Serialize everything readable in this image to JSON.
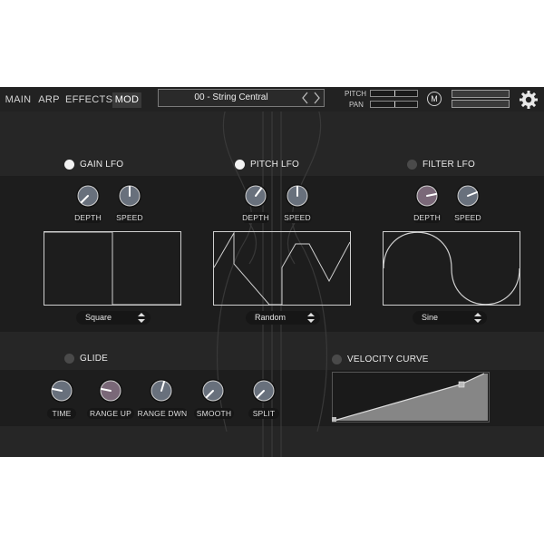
{
  "tabs": [
    {
      "label": "MAIN",
      "active": false
    },
    {
      "label": "ARP",
      "active": false
    },
    {
      "label": "EFFECTS",
      "active": false
    },
    {
      "label": "MOD",
      "active": true
    }
  ],
  "preset": {
    "name": "00 - String Central"
  },
  "header_controls": {
    "pitch_label": "PITCH",
    "pan_label": "PAN",
    "m_button": "M"
  },
  "lfo_sections": [
    {
      "title": "GAIN LFO",
      "enabled": true,
      "depth_label": "DEPTH",
      "speed_label": "SPEED",
      "waveform": "Square"
    },
    {
      "title": "PITCH LFO",
      "enabled": true,
      "depth_label": "DEPTH",
      "speed_label": "SPEED",
      "waveform": "Random"
    },
    {
      "title": "FILTER LFO",
      "enabled": false,
      "depth_label": "DEPTH",
      "speed_label": "SPEED",
      "waveform": "Sine"
    }
  ],
  "glide": {
    "title": "GLIDE",
    "enabled": false,
    "knobs": [
      {
        "label": "TIME"
      },
      {
        "label": "RANGE UP"
      },
      {
        "label": "RANGE DWN"
      },
      {
        "label": "SMOOTH"
      },
      {
        "label": "SPLIT"
      }
    ]
  },
  "velocity_curve": {
    "title": "VELOCITY CURVE",
    "enabled": false
  },
  "colors": {
    "panel": "#262626",
    "band": "#1d1d1d",
    "knob_mauve": "#7a6878",
    "knob_steel": "#68707c",
    "led_on": "#f2f2f2"
  }
}
